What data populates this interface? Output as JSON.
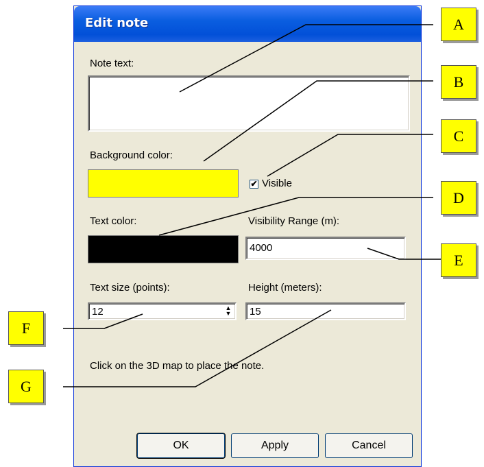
{
  "dialog": {
    "title": "Edit note",
    "note_text_label": "Note text:",
    "note_text_value": "",
    "background_color_label": "Background color:",
    "background_color": "#ffff00",
    "visible_label": "Visible",
    "visible_checked": true,
    "visible_check_glyph": "✔",
    "text_color_label": "Text color:",
    "text_color": "#000000",
    "visibility_range_label": "Visibility Range (m):",
    "visibility_range_value": "4000",
    "text_size_label": "Text size (points):",
    "text_size_value": "12",
    "height_label": "Height (meters):",
    "height_value": "15",
    "instruction": "Click on the 3D map to place the note.",
    "buttons": {
      "ok": "OK",
      "apply": "Apply",
      "cancel": "Cancel"
    }
  },
  "callouts": [
    "A",
    "B",
    "C",
    "D",
    "E",
    "F",
    "G"
  ]
}
